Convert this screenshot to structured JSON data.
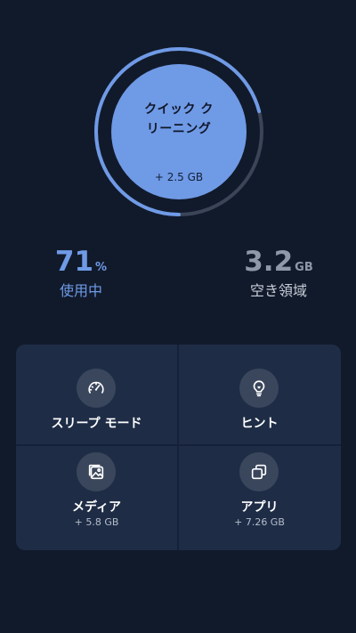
{
  "quick_clean": {
    "title_line1": "クイック ク",
    "title_line2": "リーニング",
    "size": "+ 2.5 GB",
    "usage_fraction": 0.71
  },
  "storage": {
    "used_value": "71",
    "used_unit": "%",
    "used_label": "使用中",
    "free_value": "3.2",
    "free_unit": "GB",
    "free_label": "空き領域"
  },
  "features": [
    {
      "title": "スリープ モード",
      "subtitle": "",
      "icon": "speedometer-icon"
    },
    {
      "title": "ヒント",
      "subtitle": "",
      "icon": "lightbulb-icon"
    },
    {
      "title": "メディア",
      "subtitle": "+ 5.8 GB",
      "icon": "image-gallery-icon"
    },
    {
      "title": "アプリ",
      "subtitle": "+ 7.26 GB",
      "icon": "apps-stack-icon"
    }
  ],
  "colors": {
    "background": "#111a2b",
    "accent": "#6f9ae6",
    "gauge_track": "#3b4558",
    "tile_background": "#1e2c46",
    "icon_circle": "#3a465c"
  }
}
